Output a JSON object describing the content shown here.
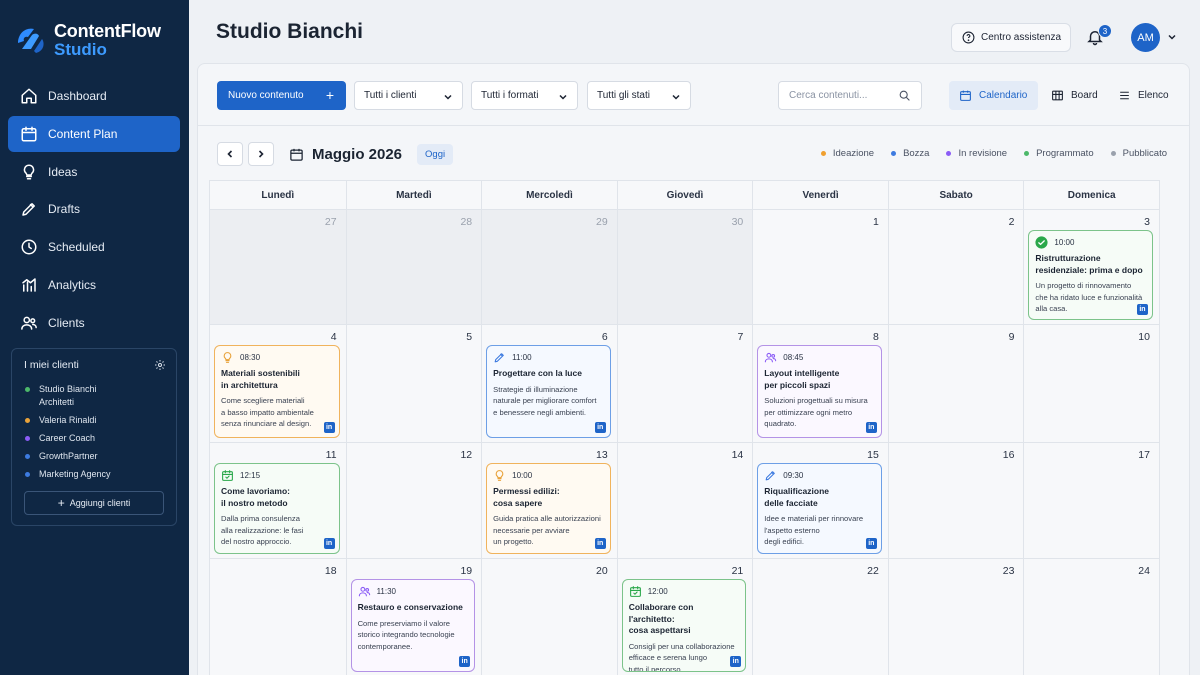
{
  "brand": {
    "title": "ContentFlow",
    "subtitle": "Studio"
  },
  "nav": [
    {
      "label": "Dashboard",
      "icon": "home-icon",
      "active": false
    },
    {
      "label": "Content Plan",
      "icon": "calendar-icon",
      "active": true
    },
    {
      "label": "Ideas",
      "icon": "lightbulb-icon",
      "active": false
    },
    {
      "label": "Drafts",
      "icon": "pencil-icon",
      "active": false
    },
    {
      "label": "Scheduled",
      "icon": "clock-icon",
      "active": false
    },
    {
      "label": "Analytics",
      "icon": "chart-icon",
      "active": false
    },
    {
      "label": "Clients",
      "icon": "users-icon",
      "active": false
    }
  ],
  "clients": {
    "heading": "I miei clienti",
    "items": [
      {
        "name": "Studio Bianchi\nArchitetti",
        "color": "#4cb86a"
      },
      {
        "name": "Valeria Rinaldi",
        "color": "#e8a23a"
      },
      {
        "name": "Career Coach",
        "color": "#8b5cf6"
      },
      {
        "name": "GrowthPartner",
        "color": "#3d7be0"
      },
      {
        "name": "Marketing Agency",
        "color": "#3d7be0"
      }
    ],
    "add_label": "Aggiungi clienti"
  },
  "header": {
    "title": "Studio Bianchi",
    "help_label": "Centro assistenza",
    "notification_count": "3",
    "avatar_initials": "AM"
  },
  "toolbar": {
    "new_label": "Nuovo contenuto",
    "filters": [
      "Tutti i clienti",
      "Tutti i formati",
      "Tutti gli stati"
    ],
    "search_placeholder": "Cerca contenuti...",
    "views": [
      {
        "label": "Calendario",
        "icon": "calendar-icon",
        "active": true
      },
      {
        "label": "Board",
        "icon": "board-icon",
        "active": false
      },
      {
        "label": "Elenco",
        "icon": "list-icon",
        "active": false
      }
    ]
  },
  "calendar": {
    "month_label": "Maggio 2026",
    "today_label": "Oggi",
    "legend": [
      {
        "label": "Ideazione",
        "color": "#f0a030"
      },
      {
        "label": "Bozza",
        "color": "#3d7be0"
      },
      {
        "label": "In revisione",
        "color": "#8b5cf6"
      },
      {
        "label": "Programmato",
        "color": "#4cb86a"
      },
      {
        "label": "Pubblicato",
        "color": "#9aa1ad"
      }
    ],
    "weekdays": [
      "Lunedì",
      "Martedì",
      "Mercoledì",
      "Giovedì",
      "Venerdì",
      "Sabato",
      "Domenica"
    ],
    "weeks": [
      [
        "27",
        "28",
        "29",
        "30",
        "1",
        "2",
        "3"
      ],
      [
        "4",
        "5",
        "6",
        "7",
        "8",
        "9",
        "10"
      ],
      [
        "11",
        "12",
        "13",
        "14",
        "15",
        "16",
        "17"
      ],
      [
        "18",
        "19",
        "20",
        "21",
        "22",
        "23",
        "24"
      ]
    ],
    "muted_days": [
      "27",
      "28",
      "29",
      "30"
    ],
    "posts": [
      {
        "week": 0,
        "day": 6,
        "status": "pub",
        "icon": "check-circle-icon",
        "time": "10:00",
        "title": "Ristrutturazione\nresidenziale: prima e dopo",
        "desc": "Un progetto di rinnovamento\nche ha ridato luce e funzionalità\nalla casa."
      },
      {
        "week": 1,
        "day": 0,
        "status": "idea",
        "icon": "lightbulb-icon",
        "time": "08:30",
        "title": "Materiali sostenibili\nin architettura",
        "desc": "Come scegliere materiali\na basso impatto ambientale\nsenza rinunciare al design."
      },
      {
        "week": 1,
        "day": 2,
        "status": "draft",
        "icon": "pencil-icon",
        "time": "11:00",
        "title": "Progettare con la luce",
        "desc": "Strategie di illuminazione\nnaturale per migliorare comfort\ne benessere negli ambienti."
      },
      {
        "week": 1,
        "day": 4,
        "status": "review",
        "icon": "users-icon",
        "time": "08:45",
        "title": "Layout intelligente\nper piccoli spazi",
        "desc": "Soluzioni progettuali su misura\nper ottimizzare ogni metro\nquadrato."
      },
      {
        "week": 2,
        "day": 0,
        "status": "sched",
        "icon": "calendar-check-icon",
        "time": "12:15",
        "title": "Come lavoriamo:\nil nostro metodo",
        "desc": "Dalla prima consulenza\nalla realizzazione: le fasi\ndel nostro approccio."
      },
      {
        "week": 2,
        "day": 2,
        "status": "idea",
        "icon": "lightbulb-icon",
        "time": "10:00",
        "title": "Permessi edilizi:\ncosa sapere",
        "desc": "Guida pratica alle autorizzazioni\nnecessarie per avviare\nun progetto."
      },
      {
        "week": 2,
        "day": 4,
        "status": "draft",
        "icon": "pencil-icon",
        "time": "09:30",
        "title": "Riqualificazione\ndelle facciate",
        "desc": "Idee e materiali per rinnovare\nl'aspetto esterno\ndegli edifici."
      },
      {
        "week": 3,
        "day": 1,
        "status": "review",
        "icon": "users-icon",
        "time": "11:30",
        "title": "Restauro e conservazione",
        "desc": "Come preserviamo il valore\nstorico integrando tecnologie\ncontemporanee."
      },
      {
        "week": 3,
        "day": 3,
        "status": "sched",
        "icon": "calendar-check-icon",
        "time": "12:00",
        "title": "Collaborare con l'architetto:\ncosa aspettarsi",
        "desc": "Consigli per una collaborazione\nefficace e serena lungo\ntutto il percorso."
      }
    ],
    "linkedin_label": "in"
  }
}
